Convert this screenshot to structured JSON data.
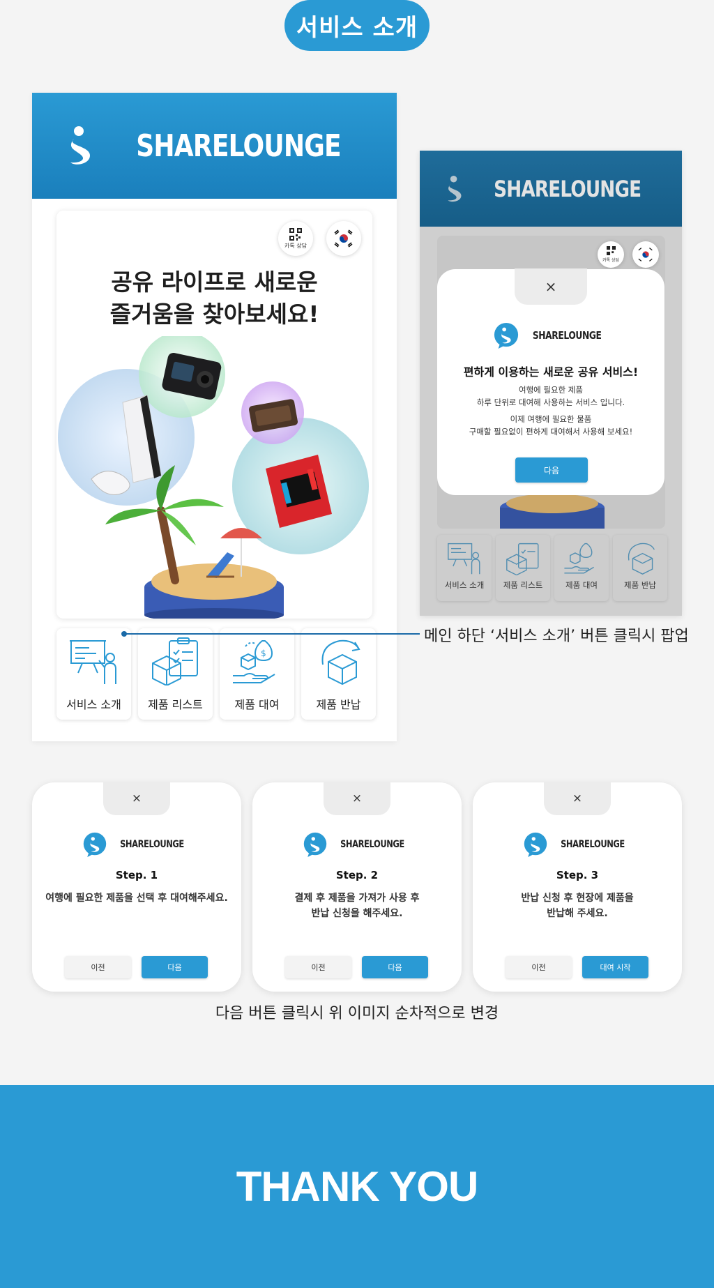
{
  "section_title": "서비스 소개",
  "brand": {
    "name": "SHARELOUNGE"
  },
  "main_screen": {
    "kakao_label": "카톡 상담",
    "hero_title": "공유 라이프로 새로운\n즐거움을 찾아보세요!",
    "menu": [
      {
        "label": "서비스 소개",
        "icon": "presentation-board-icon"
      },
      {
        "label": "제품 리스트",
        "icon": "box-checklist-icon"
      },
      {
        "label": "제품 대여",
        "icon": "hand-money-box-icon"
      },
      {
        "label": "제품 반납",
        "icon": "box-return-icon"
      }
    ]
  },
  "callout": "메인 하단 ‘서비스 소개’ 버튼 클릭시 팝업",
  "popup": {
    "close": "×",
    "heading": "편하게 이용하는 새로운 공유 서비스!",
    "body1": "여행에 필요한 제품\n하루 단위로 대여해 사용하는 서비스 입니다.",
    "body2": "이제 여행에 필요한 물품\n구매할 필요없이 편하게 대여해서 사용해 보세요!",
    "next_label": "다음"
  },
  "steps": [
    {
      "title": "Step. 1",
      "desc": "여행에 필요한 제품을 선택 후 대여해주세요.",
      "prev_label": "이전",
      "next_label": "다음"
    },
    {
      "title": "Step. 2",
      "desc": "결제 후 제품을 가져가 사용 후\n반납 신청을 해주세요.",
      "prev_label": "이전",
      "next_label": "다음"
    },
    {
      "title": "Step. 3",
      "desc": "반납 신청 후 현장에 제품을\n반납해 주세요.",
      "prev_label": "이전",
      "next_label": "대여 시작"
    }
  ],
  "steps_caption": "다음 버튼 클릭시 위 이미지 순차적으로 변경",
  "thank_you": "THANK YOU",
  "colors": {
    "accent": "#2a9ad4",
    "header_dark": "#1a7fbc"
  }
}
